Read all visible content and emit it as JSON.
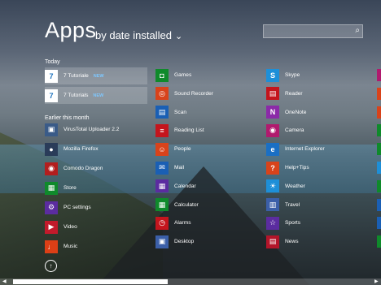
{
  "header": {
    "title": "Apps",
    "sort_label": "by date installed",
    "sort_chevron": "⌄",
    "search_icon": "⌕"
  },
  "sections": {
    "today": "Today",
    "earlier": "Earlier this month"
  },
  "col1_today": [
    {
      "label": "7 Tutoriale",
      "badge": "NEW",
      "icon": "7",
      "color": "#ffffff",
      "icon_color": "#1e73be"
    },
    {
      "label": "7 Tutorials",
      "badge": "NEW",
      "icon": "7",
      "color": "#ffffff",
      "icon_color": "#1e73be"
    }
  ],
  "col1_earlier": [
    {
      "label": "VirusTotal Uploader 2.2",
      "icon": "▣",
      "color": "#3a5b88"
    },
    {
      "label": "Mozilla Firefox",
      "icon": "●",
      "color": "#2a3c59"
    },
    {
      "label": "Comodo Dragon",
      "icon": "◉",
      "color": "#b31e1e"
    },
    {
      "label": "Store",
      "icon": "▦",
      "color": "#0f8a2b"
    },
    {
      "label": "PC settings",
      "icon": "⚙",
      "color": "#5b2ca0"
    },
    {
      "label": "Video",
      "icon": "▶",
      "color": "#c21a2b"
    },
    {
      "label": "Music",
      "icon": "♩",
      "color": "#dc3f16"
    }
  ],
  "col2": [
    {
      "label": "Games",
      "icon": "◘",
      "color": "#0f8a2b"
    },
    {
      "label": "Sound Recorder",
      "icon": "◎",
      "color": "#d8431b"
    },
    {
      "label": "Scan",
      "icon": "▤",
      "color": "#1a5fb4"
    },
    {
      "label": "Reading List",
      "icon": "≡",
      "color": "#c4151d"
    },
    {
      "label": "People",
      "icon": "☺",
      "color": "#d8431b"
    },
    {
      "label": "Mail",
      "icon": "✉",
      "color": "#1a5fb4"
    },
    {
      "label": "Calendar",
      "icon": "▦",
      "color": "#5b2ca0"
    },
    {
      "label": "Calculator",
      "icon": "▦",
      "color": "#0f8a2b"
    },
    {
      "label": "Alarms",
      "icon": "◷",
      "color": "#c4151d"
    },
    {
      "label": "Desktop",
      "icon": "▣",
      "color": "#3b5fa8"
    }
  ],
  "col3": [
    {
      "label": "Skype",
      "icon": "S",
      "color": "#1d8fd8"
    },
    {
      "label": "Reader",
      "icon": "▤",
      "color": "#c4151d"
    },
    {
      "label": "OneNote",
      "icon": "N",
      "color": "#8b2aa8"
    },
    {
      "label": "Camera",
      "icon": "◉",
      "color": "#b01a6e"
    },
    {
      "label": "Internet Explorer",
      "icon": "e",
      "color": "#1a6fc4"
    },
    {
      "label": "Help+Tips",
      "icon": "?",
      "color": "#d8431b"
    },
    {
      "label": "Weather",
      "icon": "☀",
      "color": "#1d8fd8"
    },
    {
      "label": "Travel",
      "icon": "▥",
      "color": "#3b5fa8"
    },
    {
      "label": "Sports",
      "icon": "☆",
      "color": "#5b2ca0"
    },
    {
      "label": "News",
      "icon": "▤",
      "color": "#b3152a"
    }
  ],
  "edge_colors": [
    "#b01a6e",
    "#d8431b",
    "#d8431b",
    "#0f8a2b",
    "#0f8a2b",
    "#1d8fd8",
    "#0f8a2b",
    "#1a5fb4",
    "#1a5fb4",
    "#0f8a2b"
  ],
  "footer": {
    "up_icon": "↑",
    "scroll_left": "◀",
    "scroll_right": "▶"
  }
}
